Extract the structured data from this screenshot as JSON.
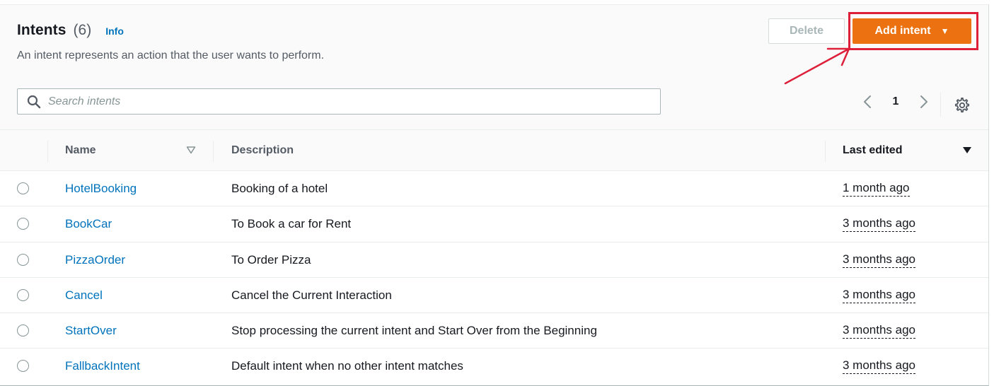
{
  "header": {
    "title": "Intents",
    "count": "(6)",
    "info_label": "Info",
    "description": "An intent represents an action that the user wants to perform.",
    "delete_label": "Delete",
    "add_label": "Add intent"
  },
  "search": {
    "placeholder": "Search intents"
  },
  "pagination": {
    "current_page": "1"
  },
  "table": {
    "columns": {
      "name": "Name",
      "description": "Description",
      "last_edited": "Last edited"
    },
    "rows": [
      {
        "name": "HotelBooking",
        "description": "Booking of a hotel",
        "last_edited": "1 month ago"
      },
      {
        "name": "BookCar",
        "description": "To Book a car for Rent",
        "last_edited": "3 months ago"
      },
      {
        "name": "PizzaOrder",
        "description": "To Order Pizza",
        "last_edited": "3 months ago"
      },
      {
        "name": "Cancel",
        "description": "Cancel the Current Interaction",
        "last_edited": "3 months ago"
      },
      {
        "name": "StartOver",
        "description": "Stop processing the current intent and Start Over from the Beginning",
        "last_edited": "3 months ago"
      },
      {
        "name": "FallbackIntent",
        "description": "Default intent when no other intent matches",
        "last_edited": "3 months ago"
      }
    ]
  },
  "icons": {
    "search": "search-icon",
    "prev": "chevron-left-icon",
    "next": "chevron-right-icon",
    "settings": "gear-icon",
    "sort_name": "sort-triangle-icon",
    "sort_edited": "sort-desc-icon",
    "dropdown": "caret-down-icon"
  },
  "colors": {
    "primary": "#ec7211",
    "link": "#0073bb",
    "annotation": "#dd1f3a"
  }
}
